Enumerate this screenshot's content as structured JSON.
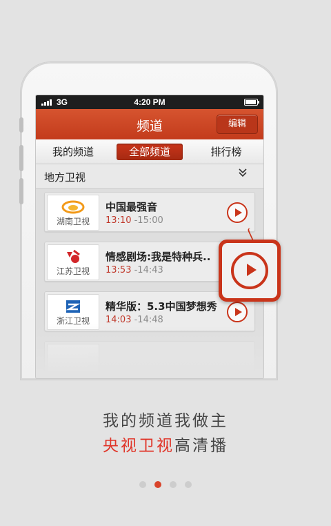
{
  "statusbar": {
    "network": "3G",
    "time": "4:20 PM"
  },
  "header": {
    "title": "频道",
    "edit_label": "编辑"
  },
  "tabs": [
    {
      "label": "我的频道",
      "active": false
    },
    {
      "label": "全部频道",
      "active": true
    },
    {
      "label": "排行榜",
      "active": false
    }
  ],
  "section": {
    "label": "地方卫视",
    "chevron_icon": "double-chevron-down-icon"
  },
  "channels": [
    {
      "name": "湖南卫视",
      "program": "中国最强音",
      "start": "13:10",
      "end": "-15:00"
    },
    {
      "name": "江苏卫视",
      "program": "情感剧场:我是特种兵..",
      "start": "13:53",
      "end": "-14:43"
    },
    {
      "name": "浙江卫视",
      "program": "精华版：5.3中国梦想秀",
      "start": "14:03",
      "end": "-14:48"
    }
  ],
  "slogan": {
    "line1": "我的频道我做主",
    "line2_highlight": "央视卫视",
    "line2_rest": "高清播"
  },
  "pagination": {
    "count": 4,
    "active_index": 1
  },
  "colors": {
    "accent": "#c9341a",
    "highlight": "#e0362a",
    "dot_active": "#d9442b"
  }
}
